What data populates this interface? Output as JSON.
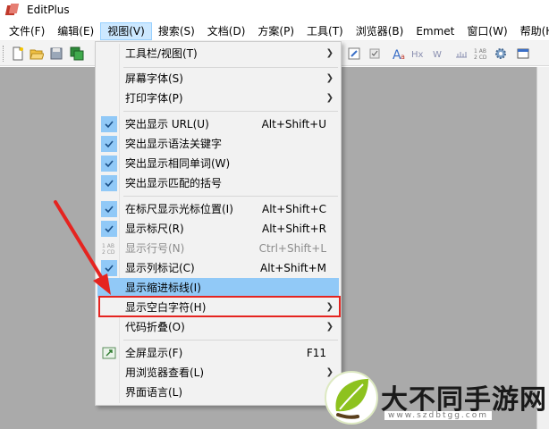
{
  "window": {
    "title": "EditPlus"
  },
  "menubar": [
    {
      "label": "文件(F)",
      "active": false
    },
    {
      "label": "编辑(E)",
      "active": false
    },
    {
      "label": "视图(V)",
      "active": true
    },
    {
      "label": "搜索(S)",
      "active": false
    },
    {
      "label": "文档(D)",
      "active": false
    },
    {
      "label": "方案(P)",
      "active": false
    },
    {
      "label": "工具(T)",
      "active": false
    },
    {
      "label": "浏览器(B)",
      "active": false
    },
    {
      "label": "Emmet",
      "active": false
    },
    {
      "label": "窗口(W)",
      "active": false
    },
    {
      "label": "帮助(H)",
      "active": false
    }
  ],
  "view_menu": {
    "items": [
      {
        "label": "工具栏/视图(T)",
        "shortcut": "",
        "submenu": true
      },
      {
        "label": "屏幕字体(S)",
        "shortcut": "",
        "submenu": true
      },
      {
        "label": "打印字体(P)",
        "shortcut": "",
        "submenu": true
      },
      {
        "label": "突出显示 URL(U)",
        "shortcut": "Alt+Shift+U",
        "checked": true
      },
      {
        "label": "突出显示语法关键字",
        "shortcut": "",
        "checked": true
      },
      {
        "label": "突出显示相同单词(W)",
        "shortcut": "",
        "checked": true
      },
      {
        "label": "突出显示匹配的括号",
        "shortcut": "",
        "checked": true
      },
      {
        "label": "在标尺显示光标位置(I)",
        "shortcut": "Alt+Shift+C",
        "checked": true
      },
      {
        "label": "显示标尺(R)",
        "shortcut": "Alt+Shift+R",
        "checked": true
      },
      {
        "label": "显示行号(N)",
        "shortcut": "Ctrl+Shift+L",
        "disabled": true,
        "icon": "line-number-icon"
      },
      {
        "label": "显示列标记(C)",
        "shortcut": "Alt+Shift+M",
        "checked": true
      },
      {
        "label": "显示缩进标线(I)",
        "shortcut": "",
        "highlighted": true
      },
      {
        "label": "显示空白字符(H)",
        "shortcut": "",
        "submenu": true,
        "boxed": true
      },
      {
        "label": "代码折叠(O)",
        "shortcut": "",
        "submenu": true
      },
      {
        "label": "全屏显示(F)",
        "shortcut": "F11",
        "icon": "fullscreen-icon"
      },
      {
        "label": "用浏览器查看(L)",
        "shortcut": "",
        "submenu": true
      },
      {
        "label": "界面语言(L)",
        "shortcut": "",
        "submenu": true
      }
    ]
  },
  "watermark": {
    "text": "大不同手游网",
    "url": "www.szdbtgg.com"
  },
  "colors": {
    "highlight": "#91c9f7",
    "menu_active": "#cce8ff",
    "annotation_red": "#e52420",
    "workspace": "#aaaaaa"
  },
  "icons": [
    "editplus-logo-icon",
    "new-file-icon",
    "open-folder-icon",
    "save-icon",
    "save-all-icon",
    "browser-icon",
    "font-icon",
    "hex-icon",
    "wordwrap-icon",
    "ruler-icon",
    "spellcheck-icon",
    "settings-gear-icon",
    "checkmark-icon",
    "submenu-arrow-icon"
  ]
}
